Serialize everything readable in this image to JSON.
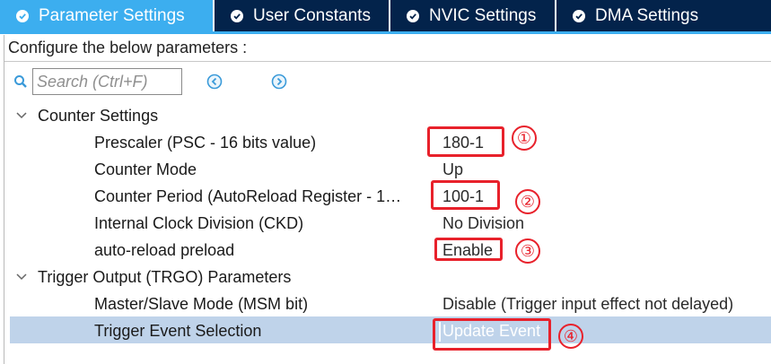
{
  "tabs": [
    {
      "label": "Parameter Settings",
      "icon": "check-circle-icon",
      "active": true
    },
    {
      "label": "User Constants",
      "icon": "check-circle-icon",
      "active": false
    },
    {
      "label": "NVIC Settings",
      "icon": "check-circle-icon",
      "active": false
    },
    {
      "label": "DMA Settings",
      "icon": "check-circle-icon",
      "active": false
    }
  ],
  "configure_text": "Configure the below parameters :",
  "search": {
    "placeholder": "Search (Ctrl+F)",
    "value": ""
  },
  "groups": [
    {
      "label": "Counter Settings",
      "params": [
        {
          "label": "Prescaler (PSC - 16 bits value)",
          "value": "180-1",
          "annotation": "①"
        },
        {
          "label": "Counter Mode",
          "value": "Up",
          "annotation": ""
        },
        {
          "label": "Counter Period (AutoReload Register - 1…",
          "value": "100-1",
          "annotation": "②"
        },
        {
          "label": "Internal Clock Division (CKD)",
          "value": "No Division",
          "annotation": ""
        },
        {
          "label": "auto-reload preload",
          "value": "Enable",
          "annotation": "③"
        }
      ]
    },
    {
      "label": "Trigger Output (TRGO) Parameters",
      "params": [
        {
          "label": "Master/Slave Mode (MSM bit)",
          "value": "Disable (Trigger input effect not delayed)",
          "annotation": ""
        },
        {
          "label": "Trigger Event Selection",
          "value": "Update Event",
          "annotation": "④"
        }
      ]
    }
  ],
  "colors": {
    "tab_inactive": "#03234b",
    "tab_active": "#3caeef",
    "selected_row": "#bfd3ea",
    "annotation_red": "#e8212b",
    "nav_blue": "#3a9ad9"
  }
}
